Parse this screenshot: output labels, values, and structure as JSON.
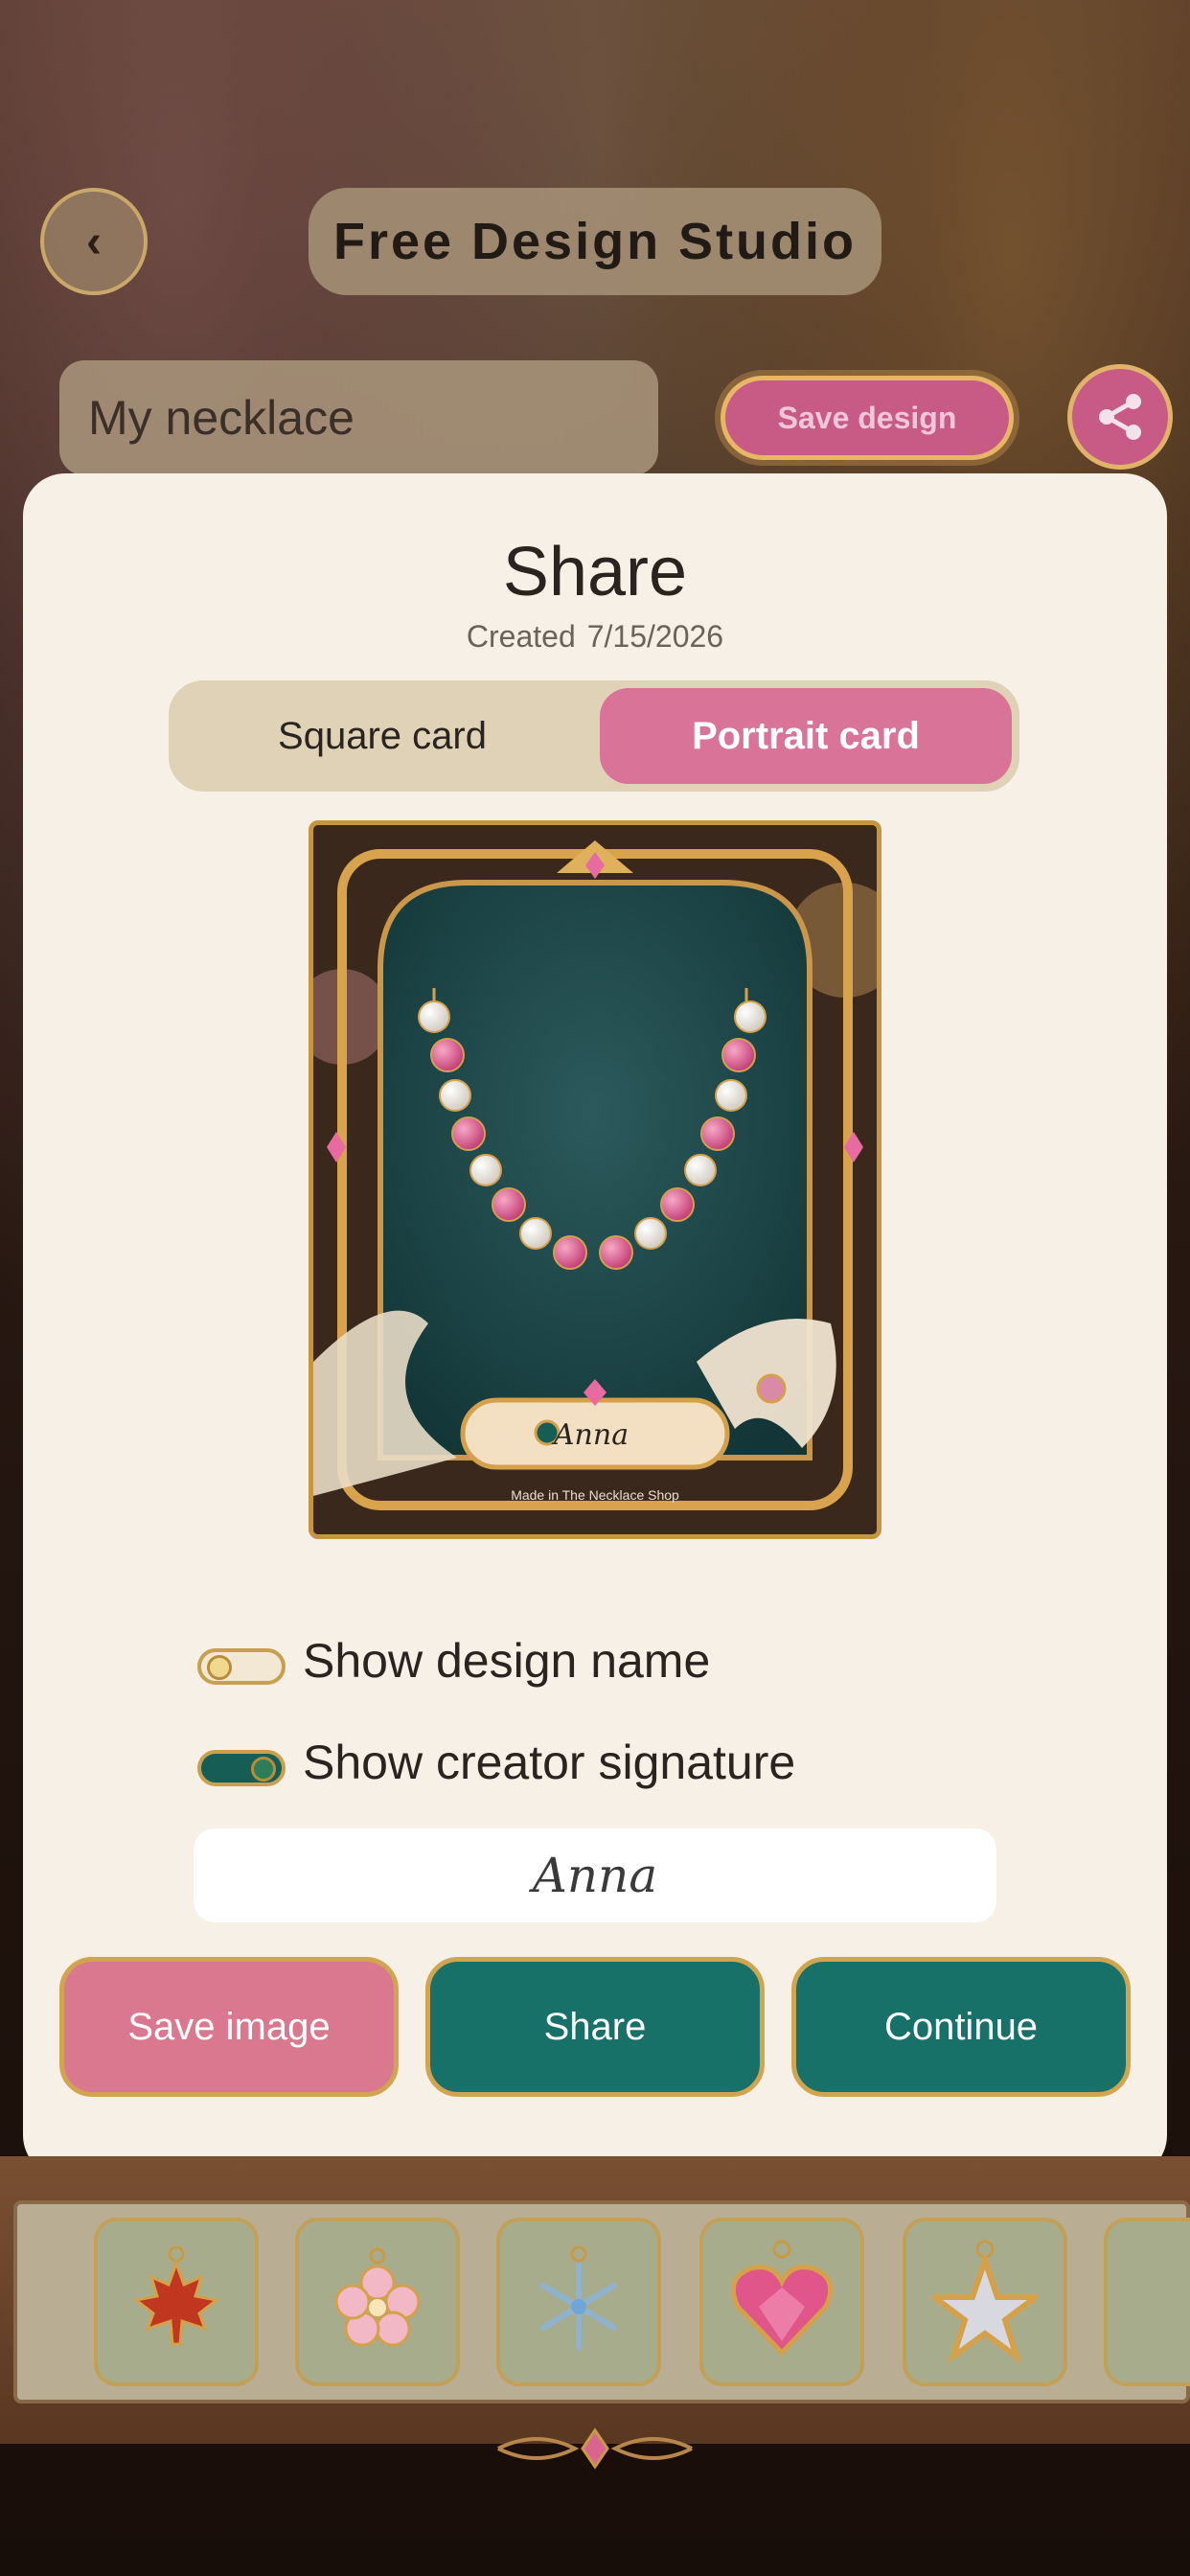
{
  "header": {
    "back_label": "‹",
    "title": "Free Design Studio"
  },
  "design_name": {
    "value": "My necklace"
  },
  "toolbar": {
    "save_design_label": "Save design"
  },
  "share_modal": {
    "title": "Share",
    "created_label": "Created",
    "created_date": "7/15/2026",
    "tabs": [
      {
        "label": "Square card",
        "selected": false
      },
      {
        "label": "Portrait card",
        "selected": true
      }
    ],
    "card": {
      "signature": "Anna",
      "footer_text": "Made in The Necklace Shop"
    },
    "options": {
      "show_design_name": {
        "label": "Show design name",
        "on": false
      },
      "show_creator_signature": {
        "label": "Show creator signature",
        "on": true
      }
    },
    "signature_value": "Anna",
    "buttons": {
      "save_image": "Save image",
      "share": "Share",
      "continue": "Continue"
    }
  },
  "charm_tray": {
    "items": [
      {
        "icon": "maple-leaf-icon"
      },
      {
        "icon": "cherry-blossom-icon"
      },
      {
        "icon": "snowflake-icon"
      },
      {
        "icon": "heart-gem-icon"
      },
      {
        "icon": "star-icon"
      }
    ]
  },
  "colors": {
    "accent_pink": "#d97498",
    "accent_teal": "#177168",
    "gold": "#c7943f",
    "modal_bg": "#f6f0e6"
  }
}
